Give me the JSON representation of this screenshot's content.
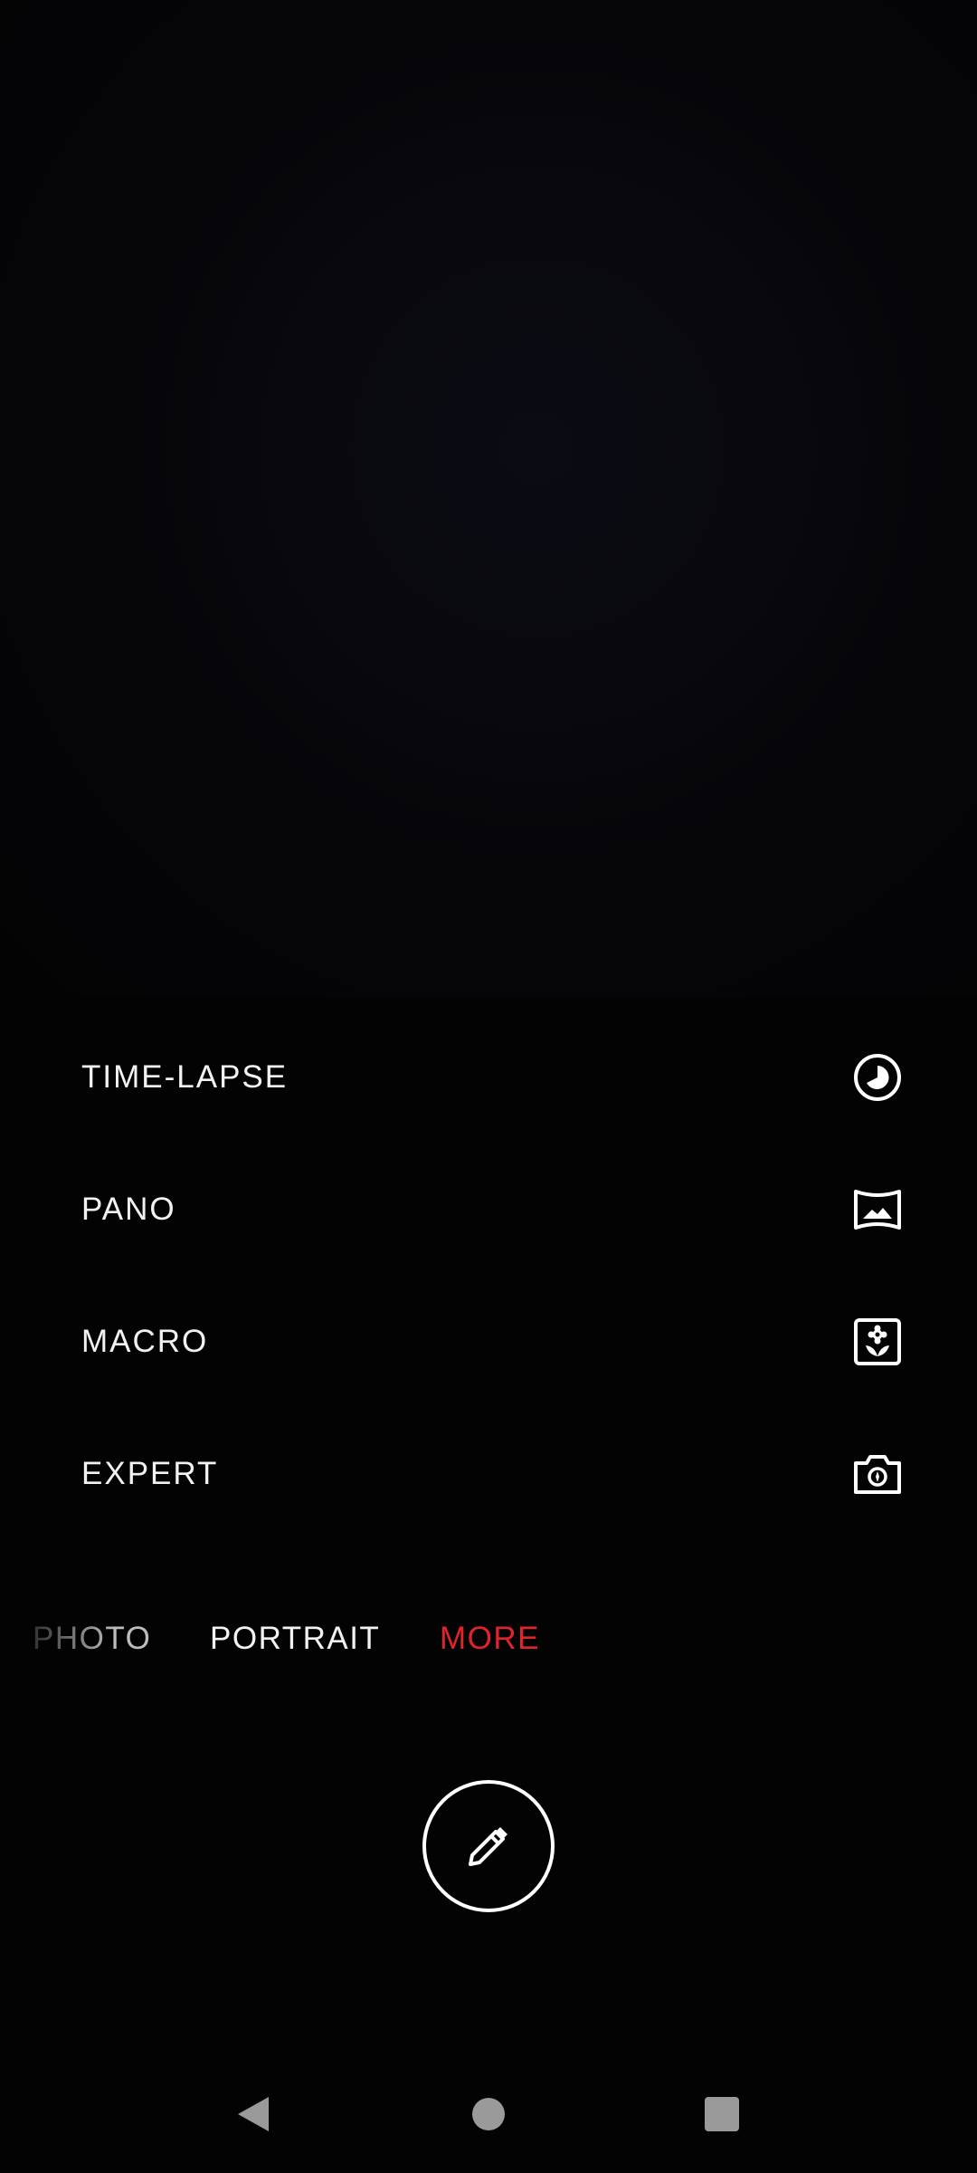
{
  "more_modes": [
    {
      "label": "TIME-LAPSE",
      "icon": "time-lapse-icon"
    },
    {
      "label": "PANO",
      "icon": "panorama-icon"
    },
    {
      "label": "MACRO",
      "icon": "macro-flower-icon"
    },
    {
      "label": "EXPERT",
      "icon": "expert-camera-icon"
    }
  ],
  "mode_strip": {
    "photo": "PHOTO",
    "portrait": "PORTRAIT",
    "more": "MORE",
    "active_color": "#e0242b"
  },
  "shutter": {
    "icon": "pencil-edit-icon"
  },
  "navigation": {
    "back_icon": "back-triangle-icon",
    "home_icon": "home-circle-icon",
    "recents_icon": "recents-square-icon"
  }
}
